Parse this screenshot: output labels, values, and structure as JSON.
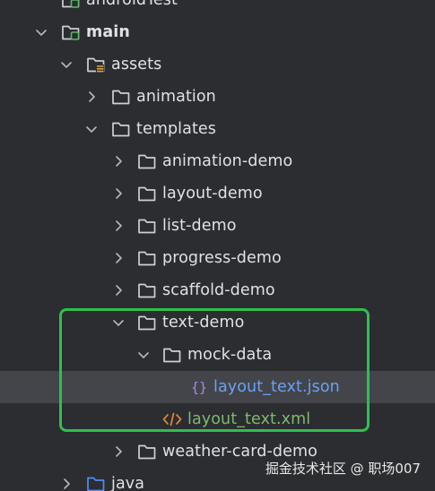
{
  "tree": {
    "nodes": [
      {
        "label": "androidTest",
        "icon": "module-folder-icon",
        "chevron": "none",
        "level": 1
      },
      {
        "label": "main",
        "icon": "module-folder-icon",
        "chevron": "down",
        "level": 1,
        "bold": true
      },
      {
        "label": "assets",
        "icon": "resources-folder-icon",
        "chevron": "down",
        "level": 2
      },
      {
        "label": "animation",
        "icon": "folder-icon",
        "chevron": "right",
        "level": 3
      },
      {
        "label": "templates",
        "icon": "folder-icon",
        "chevron": "down",
        "level": 3
      },
      {
        "label": "animation-demo",
        "icon": "folder-icon",
        "chevron": "right",
        "level": 4
      },
      {
        "label": "layout-demo",
        "icon": "folder-icon",
        "chevron": "right",
        "level": 4
      },
      {
        "label": "list-demo",
        "icon": "folder-icon",
        "chevron": "right",
        "level": 4
      },
      {
        "label": "progress-demo",
        "icon": "folder-icon",
        "chevron": "right",
        "level": 4
      },
      {
        "label": "scaffold-demo",
        "icon": "folder-icon",
        "chevron": "right",
        "level": 4
      },
      {
        "label": "text-demo",
        "icon": "folder-icon",
        "chevron": "down",
        "level": 4
      },
      {
        "label": "mock-data",
        "icon": "folder-icon",
        "chevron": "down",
        "level": 5
      },
      {
        "label": "layout_text.json",
        "icon": "json-file-icon",
        "chevron": "none",
        "level": 6,
        "selected": true,
        "kind": "json"
      },
      {
        "label": "layout_text.xml",
        "icon": "xml-file-icon",
        "chevron": "none",
        "level": 5,
        "kind": "xml"
      },
      {
        "label": "weather-card-demo",
        "icon": "folder-icon",
        "chevron": "right",
        "level": 4
      },
      {
        "label": "java",
        "icon": "source-folder-icon",
        "chevron": "right",
        "level": 2
      }
    ]
  },
  "highlight_color": "#2fbf4f",
  "colors": {
    "background": "#2b2d30",
    "selection": "#43454a",
    "text": "#dfe1e5",
    "json": "#6aa0f5",
    "xml": "#7fb86e"
  },
  "watermark": "掘金技术社区 @ 职场007"
}
